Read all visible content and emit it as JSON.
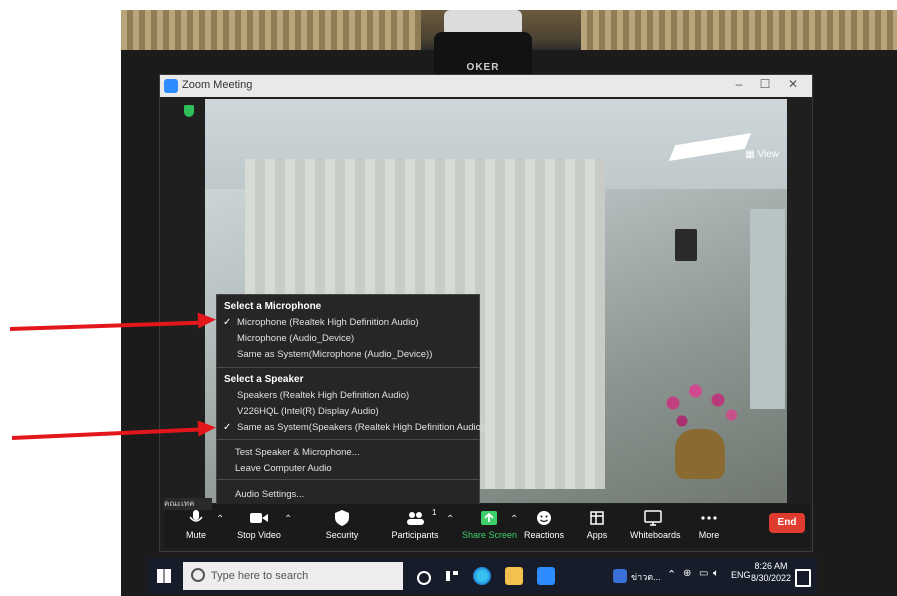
{
  "window": {
    "title": "Zoom Meeting"
  },
  "video": {
    "view_label": "View"
  },
  "webcam": {
    "brand": "OKER"
  },
  "audio_menu": {
    "microphone_section": "Select a Microphone",
    "microphones": [
      {
        "label": "Microphone (Realtek High Definition Audio)",
        "checked": true
      },
      {
        "label": "Microphone (Audio_Device)",
        "checked": false
      },
      {
        "label": "Same as System(Microphone (Audio_Device))",
        "checked": false
      }
    ],
    "speaker_section": "Select a Speaker",
    "speakers": [
      {
        "label": "Speakers (Realtek High Definition Audio)",
        "checked": false
      },
      {
        "label": "V226HQL (Intel(R) Display Audio)",
        "checked": false
      },
      {
        "label": "Same as System(Speakers (Realtek High Definition Audio))",
        "checked": true
      }
    ],
    "test_label": "Test Speaker & Microphone...",
    "leave_label": "Leave Computer Audio",
    "settings_label": "Audio Settings..."
  },
  "toolbar": {
    "mute": "Mute",
    "stop_video": "Stop Video",
    "security": "Security",
    "participants": "Participants",
    "participants_count": "1",
    "share_screen": "Share Screen",
    "reactions": "Reactions",
    "apps": "Apps",
    "whiteboards": "Whiteboards",
    "more": "More",
    "end": "End",
    "name_tag": "คณะเทคโนโล"
  },
  "taskbar": {
    "search_placeholder": "Type here to search",
    "tray_app": "ข่าวต...",
    "lang": "ENG",
    "time": "8:26 AM",
    "date": "8/30/2022"
  },
  "colors": {
    "end_red": "#e03b2f",
    "share_green": "#3fcf6a",
    "arrow_red": "#e3161b"
  }
}
